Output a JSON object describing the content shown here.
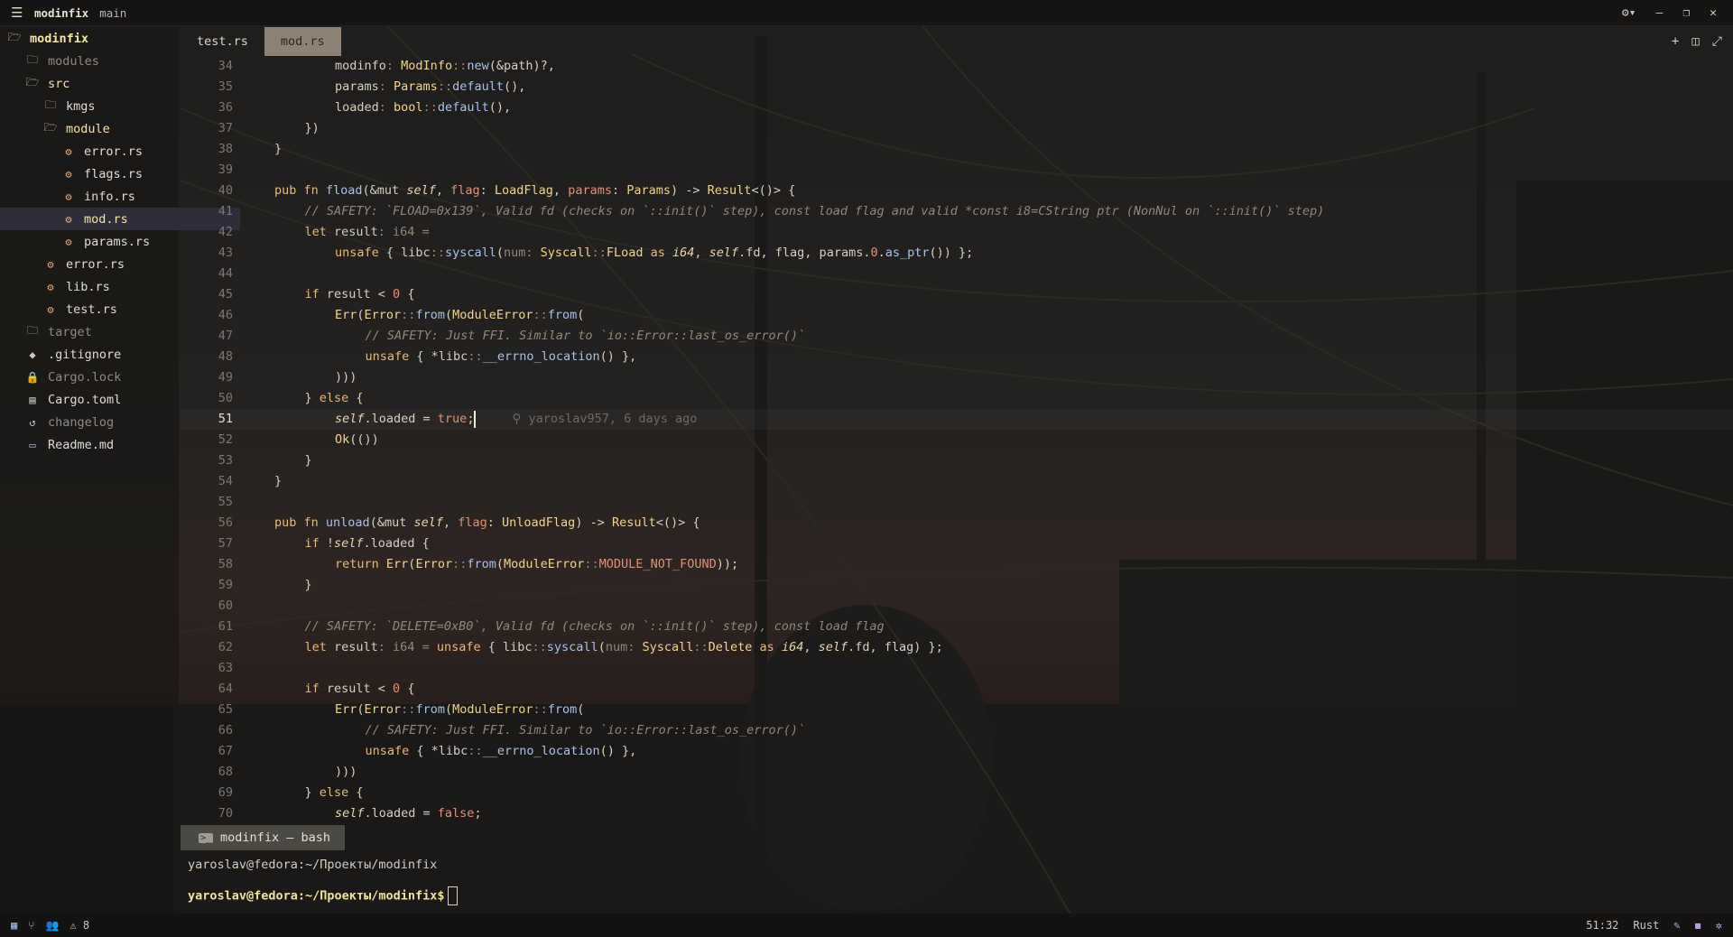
{
  "titlebar": {
    "project": "modinfix",
    "branch": "main"
  },
  "sidebar": {
    "items": [
      {
        "label": "modinfix",
        "icon": "folder-open-icon",
        "level": 0,
        "color": "#f2e6a8",
        "bold": true
      },
      {
        "label": "modules",
        "icon": "folder-icon",
        "level": 1,
        "color": "#8e8a82"
      },
      {
        "label": "src",
        "icon": "folder-open-icon",
        "level": 1,
        "color": "#f2e6a8"
      },
      {
        "label": "kmgs",
        "icon": "folder-icon",
        "level": 2,
        "color": "#e0dbd0"
      },
      {
        "label": "module",
        "icon": "folder-open-icon",
        "level": 2,
        "color": "#f2e6a8"
      },
      {
        "label": "error.rs",
        "icon": "rust-icon",
        "level": 3,
        "color": "#e0dbd0"
      },
      {
        "label": "flags.rs",
        "icon": "rust-icon",
        "level": 3,
        "color": "#e0dbd0"
      },
      {
        "label": "info.rs",
        "icon": "rust-icon",
        "level": 3,
        "color": "#e0dbd0"
      },
      {
        "label": "mod.rs",
        "icon": "rust-icon",
        "level": 3,
        "color": "#f2e6a8",
        "selected": true
      },
      {
        "label": "params.rs",
        "icon": "rust-icon",
        "level": 3,
        "color": "#e0dbd0"
      },
      {
        "label": "error.rs",
        "icon": "rust-icon",
        "level": 2,
        "color": "#e0dbd0"
      },
      {
        "label": "lib.rs",
        "icon": "rust-icon",
        "level": 2,
        "color": "#e0dbd0"
      },
      {
        "label": "test.rs",
        "icon": "rust-icon",
        "level": 2,
        "color": "#e0dbd0"
      },
      {
        "label": "target",
        "icon": "folder-icon",
        "level": 1,
        "color": "#8e8a82"
      },
      {
        "label": ".gitignore",
        "icon": "git-icon",
        "level": 1,
        "color": "#e0dbd0"
      },
      {
        "label": "Cargo.lock",
        "icon": "lock-icon",
        "level": 1,
        "color": "#8e8a82"
      },
      {
        "label": "Cargo.toml",
        "icon": "toml-icon",
        "level": 1,
        "color": "#e0dbd0"
      },
      {
        "label": "changelog",
        "icon": "history-icon",
        "level": 1,
        "color": "#8e8a82"
      },
      {
        "label": "Readme.md",
        "icon": "markdown-icon",
        "level": 1,
        "color": "#e0dbd0"
      }
    ]
  },
  "tabs": [
    {
      "label": "test.rs",
      "active": false
    },
    {
      "label": "mod.rs",
      "active": true
    }
  ],
  "editor": {
    "current_line": 51,
    "blame": "yaroslav957, 6 days ago",
    "lines": [
      {
        "n": "34",
        "ind": 3,
        "t": [
          [
            "modinfo",
            ""
          ],
          [
            ": ",
            "pa"
          ],
          [
            "ModInfo",
            "ty"
          ],
          [
            "::",
            "pa"
          ],
          [
            "new",
            "fn"
          ],
          [
            "(&path)?,",
            ""
          ]
        ]
      },
      {
        "n": "35",
        "ind": 3,
        "t": [
          [
            "params",
            ""
          ],
          [
            ": ",
            "pa"
          ],
          [
            "Params",
            "ty"
          ],
          [
            "::",
            "pa"
          ],
          [
            "default",
            "fn"
          ],
          [
            "(),",
            ""
          ]
        ]
      },
      {
        "n": "36",
        "ind": 3,
        "t": [
          [
            "loaded",
            ""
          ],
          [
            ": ",
            "pa"
          ],
          [
            "bool",
            "ty"
          ],
          [
            "::",
            "pa"
          ],
          [
            "default",
            "fn"
          ],
          [
            "(),",
            ""
          ]
        ]
      },
      {
        "n": "37",
        "ind": 2,
        "t": [
          [
            "})",
            ""
          ]
        ]
      },
      {
        "n": "38",
        "ind": 1,
        "t": [
          [
            "}",
            ""
          ]
        ]
      },
      {
        "n": "39",
        "ind": 0,
        "t": []
      },
      {
        "n": "40",
        "ind": 1,
        "t": [
          [
            "pub fn ",
            "kw"
          ],
          [
            "fload",
            "fn"
          ],
          [
            "(&mut ",
            ""
          ],
          [
            "self",
            "it"
          ],
          [
            ", ",
            ""
          ],
          [
            "flag",
            "nm"
          ],
          [
            ": ",
            ""
          ],
          [
            "LoadFlag",
            "ty"
          ],
          [
            ", ",
            ""
          ],
          [
            "params",
            "nm"
          ],
          [
            ": ",
            ""
          ],
          [
            "Params",
            "ty"
          ],
          [
            ") -> ",
            ""
          ],
          [
            "Result",
            "ty"
          ],
          [
            "<()> {",
            ""
          ]
        ]
      },
      {
        "n": "41",
        "ind": 2,
        "t": [
          [
            "// SAFETY: `FLOAD=0x139`, Valid fd (checks on `::init()` step), const load flag and valid *const i8=CString ptr (NonNul on `::init()` step)",
            "cm"
          ]
        ]
      },
      {
        "n": "42",
        "ind": 2,
        "t": [
          [
            "let ",
            "kw"
          ],
          [
            "result",
            ""
          ],
          [
            ": i64 =",
            "pa"
          ]
        ]
      },
      {
        "n": "43",
        "ind": 3,
        "t": [
          [
            "unsafe ",
            "kw"
          ],
          [
            "{ libc",
            ""
          ],
          [
            "::",
            "pa"
          ],
          [
            "syscall",
            "fn"
          ],
          [
            "(",
            ""
          ],
          [
            "num: ",
            "pa"
          ],
          [
            "Syscall",
            "ty"
          ],
          [
            "::",
            "pa"
          ],
          [
            "FLoad ",
            "ty"
          ],
          [
            "as ",
            "kw"
          ],
          [
            "i64",
            "it"
          ],
          [
            ", ",
            ""
          ],
          [
            "self",
            "it"
          ],
          [
            ".fd, flag, params.",
            ""
          ],
          [
            "0",
            "nm"
          ],
          [
            ".",
            ""
          ],
          [
            "as_ptr",
            "fn"
          ],
          [
            "()) };",
            ""
          ]
        ]
      },
      {
        "n": "44",
        "ind": 0,
        "t": []
      },
      {
        "n": "45",
        "ind": 2,
        "t": [
          [
            "if ",
            "kw"
          ],
          [
            "result < ",
            ""
          ],
          [
            "0",
            "nm"
          ],
          [
            " {",
            ""
          ]
        ]
      },
      {
        "n": "46",
        "ind": 3,
        "t": [
          [
            "Err",
            "ty"
          ],
          [
            "(",
            ""
          ],
          [
            "Error",
            "ty"
          ],
          [
            "::",
            "pa"
          ],
          [
            "from",
            "fn"
          ],
          [
            "(",
            ""
          ],
          [
            "ModuleError",
            "ty"
          ],
          [
            "::",
            "pa"
          ],
          [
            "from",
            "fn"
          ],
          [
            "(",
            ""
          ]
        ]
      },
      {
        "n": "47",
        "ind": 4,
        "t": [
          [
            "// SAFETY: Just FFI. Similar to `io::Error::last_os_error()`",
            "cm"
          ]
        ]
      },
      {
        "n": "48",
        "ind": 4,
        "t": [
          [
            "unsafe ",
            "kw"
          ],
          [
            "{ *libc",
            ""
          ],
          [
            "::",
            "pa"
          ],
          [
            "__errno_location",
            "fn"
          ],
          [
            "() },",
            ""
          ]
        ]
      },
      {
        "n": "49",
        "ind": 3,
        "t": [
          [
            ")))",
            ""
          ]
        ]
      },
      {
        "n": "50",
        "ind": 2,
        "t": [
          [
            "} ",
            ""
          ],
          [
            "else ",
            "kw"
          ],
          [
            "{",
            ""
          ]
        ]
      },
      {
        "n": "51",
        "ind": 3,
        "t": [
          [
            "self",
            "it"
          ],
          [
            ".loaded = ",
            ""
          ],
          [
            "true",
            "nm"
          ],
          [
            ";",
            ""
          ]
        ],
        "cursor": true
      },
      {
        "n": "52",
        "ind": 3,
        "t": [
          [
            "Ok",
            "ty"
          ],
          [
            "(())",
            ""
          ]
        ]
      },
      {
        "n": "53",
        "ind": 2,
        "t": [
          [
            "}",
            ""
          ]
        ]
      },
      {
        "n": "54",
        "ind": 1,
        "t": [
          [
            "}",
            ""
          ]
        ]
      },
      {
        "n": "55",
        "ind": 0,
        "t": []
      },
      {
        "n": "56",
        "ind": 1,
        "t": [
          [
            "pub fn ",
            "kw"
          ],
          [
            "unload",
            "fn"
          ],
          [
            "(&mut ",
            ""
          ],
          [
            "self",
            "it"
          ],
          [
            ", ",
            ""
          ],
          [
            "flag",
            "nm"
          ],
          [
            ": ",
            ""
          ],
          [
            "UnloadFlag",
            "ty"
          ],
          [
            ") -> ",
            ""
          ],
          [
            "Result",
            "ty"
          ],
          [
            "<()> {",
            ""
          ]
        ]
      },
      {
        "n": "57",
        "ind": 2,
        "t": [
          [
            "if ",
            "kw"
          ],
          [
            "!",
            ""
          ],
          [
            "self",
            "it"
          ],
          [
            ".loaded {",
            ""
          ]
        ]
      },
      {
        "n": "58",
        "ind": 3,
        "t": [
          [
            "return ",
            "kw"
          ],
          [
            "Err",
            "ty"
          ],
          [
            "(",
            ""
          ],
          [
            "Error",
            "ty"
          ],
          [
            "::",
            "pa"
          ],
          [
            "from",
            "fn"
          ],
          [
            "(",
            ""
          ],
          [
            "ModuleError",
            "ty"
          ],
          [
            "::",
            "pa"
          ],
          [
            "MODULE_NOT_FOUND",
            "nm"
          ],
          [
            "));",
            ""
          ]
        ]
      },
      {
        "n": "59",
        "ind": 2,
        "t": [
          [
            "}",
            ""
          ]
        ]
      },
      {
        "n": "60",
        "ind": 0,
        "t": []
      },
      {
        "n": "61",
        "ind": 2,
        "t": [
          [
            "// SAFETY: `DELETE=0xB0`, Valid fd (checks on `::init()` step), const load flag",
            "cm"
          ]
        ]
      },
      {
        "n": "62",
        "ind": 2,
        "t": [
          [
            "let ",
            "kw"
          ],
          [
            "result",
            ""
          ],
          [
            ": i64 = ",
            "pa"
          ],
          [
            "unsafe ",
            "kw"
          ],
          [
            "{ libc",
            ""
          ],
          [
            "::",
            "pa"
          ],
          [
            "syscall",
            "fn"
          ],
          [
            "(",
            ""
          ],
          [
            "num: ",
            "pa"
          ],
          [
            "Syscall",
            "ty"
          ],
          [
            "::",
            "pa"
          ],
          [
            "Delete ",
            "ty"
          ],
          [
            "as ",
            "kw"
          ],
          [
            "i64",
            "it"
          ],
          [
            ", ",
            ""
          ],
          [
            "self",
            "it"
          ],
          [
            ".fd, flag) };",
            ""
          ]
        ]
      },
      {
        "n": "63",
        "ind": 0,
        "t": []
      },
      {
        "n": "64",
        "ind": 2,
        "t": [
          [
            "if ",
            "kw"
          ],
          [
            "result < ",
            ""
          ],
          [
            "0",
            "nm"
          ],
          [
            " {",
            ""
          ]
        ]
      },
      {
        "n": "65",
        "ind": 3,
        "t": [
          [
            "Err",
            "ty"
          ],
          [
            "(",
            ""
          ],
          [
            "Error",
            "ty"
          ],
          [
            "::",
            "pa"
          ],
          [
            "from",
            "fn"
          ],
          [
            "(",
            ""
          ],
          [
            "ModuleError",
            "ty"
          ],
          [
            "::",
            "pa"
          ],
          [
            "from",
            "fn"
          ],
          [
            "(",
            ""
          ]
        ]
      },
      {
        "n": "66",
        "ind": 4,
        "t": [
          [
            "// SAFETY: Just FFI. Similar to `io::Error::last_os_error()`",
            "cm"
          ]
        ]
      },
      {
        "n": "67",
        "ind": 4,
        "t": [
          [
            "unsafe ",
            "kw"
          ],
          [
            "{ *libc",
            ""
          ],
          [
            "::",
            "pa"
          ],
          [
            "__errno_location",
            "fn"
          ],
          [
            "() },",
            ""
          ]
        ]
      },
      {
        "n": "68",
        "ind": 3,
        "t": [
          [
            ")))",
            ""
          ]
        ]
      },
      {
        "n": "69",
        "ind": 2,
        "t": [
          [
            "} ",
            ""
          ],
          [
            "else ",
            "kw"
          ],
          [
            "{",
            ""
          ]
        ]
      },
      {
        "n": "70",
        "ind": 3,
        "t": [
          [
            "self",
            "it"
          ],
          [
            ".loaded = ",
            ""
          ],
          [
            "false",
            "nm"
          ],
          [
            ";",
            ""
          ]
        ]
      }
    ]
  },
  "terminal": {
    "tab_label": "modinfix — bash",
    "line1": "yaroslav@fedora:~/Проекты/modinfix",
    "prompt": "yaroslav@fedora:~/Проекты/modinfix$"
  },
  "statusbar": {
    "warnings": "8",
    "position": "51:32",
    "language": "Rust"
  }
}
